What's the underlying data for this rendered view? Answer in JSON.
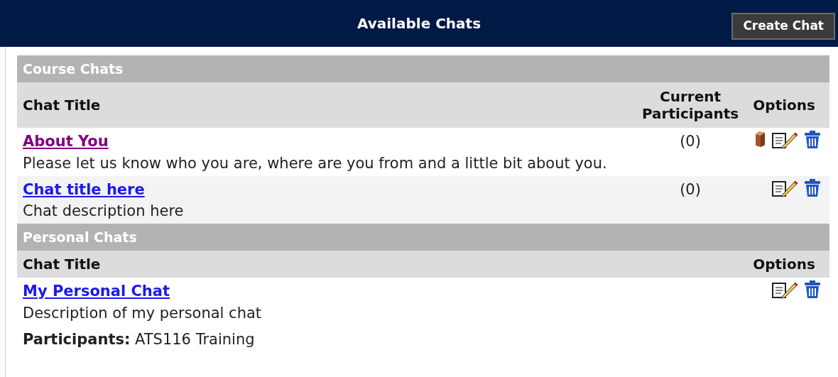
{
  "header": {
    "title": "Available Chats",
    "button": "Create Chat"
  },
  "sections": [
    {
      "title": "Course Chats",
      "columns": [
        {
          "kind": "title",
          "label": "Chat Title"
        },
        {
          "kind": "participants",
          "label": "Current Participants"
        },
        {
          "kind": "options",
          "label": "Options"
        }
      ],
      "chats": [
        {
          "title": "About You",
          "visited": true,
          "description": "Please let us know who you are, where are you from and a little bit about you.",
          "participants": "(0)",
          "icons": [
            {
              "kind": "book"
            },
            {
              "kind": "edit"
            },
            {
              "kind": "delete"
            }
          ]
        },
        {
          "title": "Chat title here",
          "visited": false,
          "description": "Chat description here",
          "participants": "(0)",
          "icons": [
            {
              "kind": "edit"
            },
            {
              "kind": "delete"
            }
          ]
        }
      ]
    },
    {
      "title": "Personal Chats",
      "columns": [
        {
          "kind": "title",
          "label": "Chat Title"
        },
        {
          "kind": "options",
          "label": "Options"
        }
      ],
      "chats": [
        {
          "title": "My Personal Chat",
          "visited": false,
          "description": "Description of my personal chat",
          "member_line": "**Participants:** ATS116 Training",
          "icons": [
            {
              "kind": "edit"
            },
            {
              "kind": "delete"
            }
          ]
        }
      ]
    }
  ]
}
